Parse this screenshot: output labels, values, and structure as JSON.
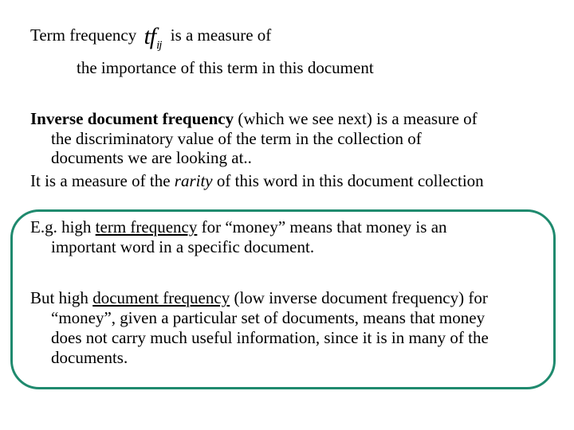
{
  "slide": {
    "term_frequency": {
      "lead": "Term frequency",
      "symbol_main": "tf",
      "symbol_sub": "ij",
      "rest": "is a measure of",
      "line2": "the importance of this  term  in  this document"
    },
    "idf": {
      "bold_term": "Inverse document frequency",
      "line1_rest": " (which we see next) is a measure of",
      "line2": "the discriminatory value of the term in the collection of",
      "line3": "documents we are looking at..",
      "rarity_pre": "It is a measure of the ",
      "rarity_word": "rarity",
      "rarity_post": " of this word in this document collection"
    },
    "example_box": {
      "border_color": "#1f8a6e",
      "tf_example": {
        "pre": "E.g.  high ",
        "underlined": "term frequency",
        "post": " for “money” means that money is an",
        "line2": "important word in a specific document."
      },
      "df_example": {
        "pre": "But high ",
        "underlined": "document frequency",
        "post": " (low inverse document frequency) for",
        "line2": "“money”, given a particular set of documents, means that money",
        "line3": "does not carry much useful information, since it is in many of the",
        "line4": "documents."
      }
    }
  }
}
